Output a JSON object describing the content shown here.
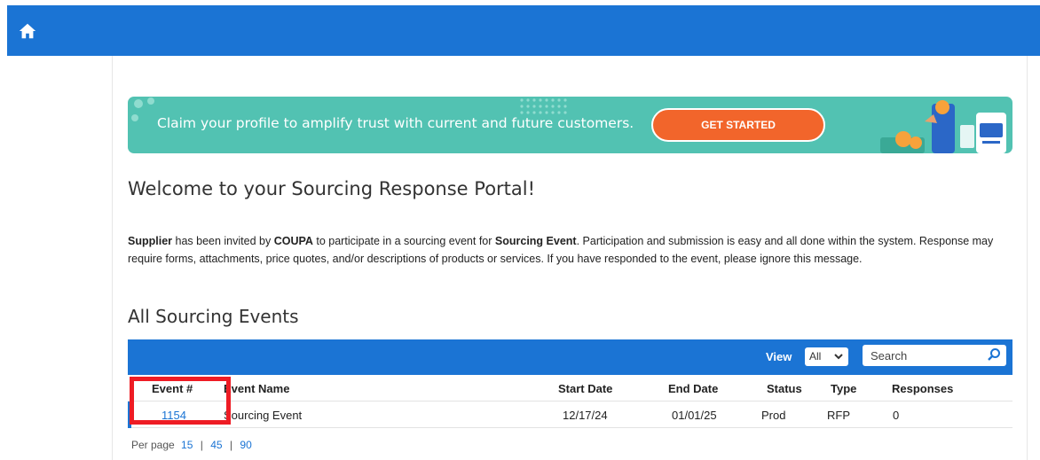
{
  "topbar": {
    "home_icon": "home-icon",
    "color": "#1b74d4"
  },
  "banner": {
    "text": "Claim your profile to amplify trust with current and future customers.",
    "cta_label": "GET STARTED",
    "bg_color": "#52c2b2",
    "cta_color": "#f2652b"
  },
  "welcome_title": "Welcome to your Sourcing Response Portal!",
  "intro": {
    "supplier": "Supplier",
    "t1": " has been invited by ",
    "company": "COUPA",
    "t2": " to participate in a sourcing event for ",
    "event": "Sourcing Event",
    "t3": ". Participation and submission is easy and all done within the system. Response may require forms, attachments, price quotes, and/or descriptions of products or services. If you have responded to the event, please ignore this message."
  },
  "events_title": "All Sourcing Events",
  "toolbar": {
    "view_label": "View",
    "view_value": "All",
    "search_placeholder": "Search"
  },
  "table": {
    "headers": [
      "Event #",
      "Event Name",
      "Start Date",
      "End Date",
      "Status",
      "Type",
      "Responses"
    ],
    "rows": [
      [
        "1154",
        "Sourcing Event",
        "12/17/24",
        "01/01/25",
        "Prod",
        "RFP",
        "0"
      ]
    ]
  },
  "pager": {
    "label": "Per page",
    "options": [
      "15",
      "45",
      "90"
    ],
    "separator": "|"
  },
  "annotation_color": "#ee1c24"
}
